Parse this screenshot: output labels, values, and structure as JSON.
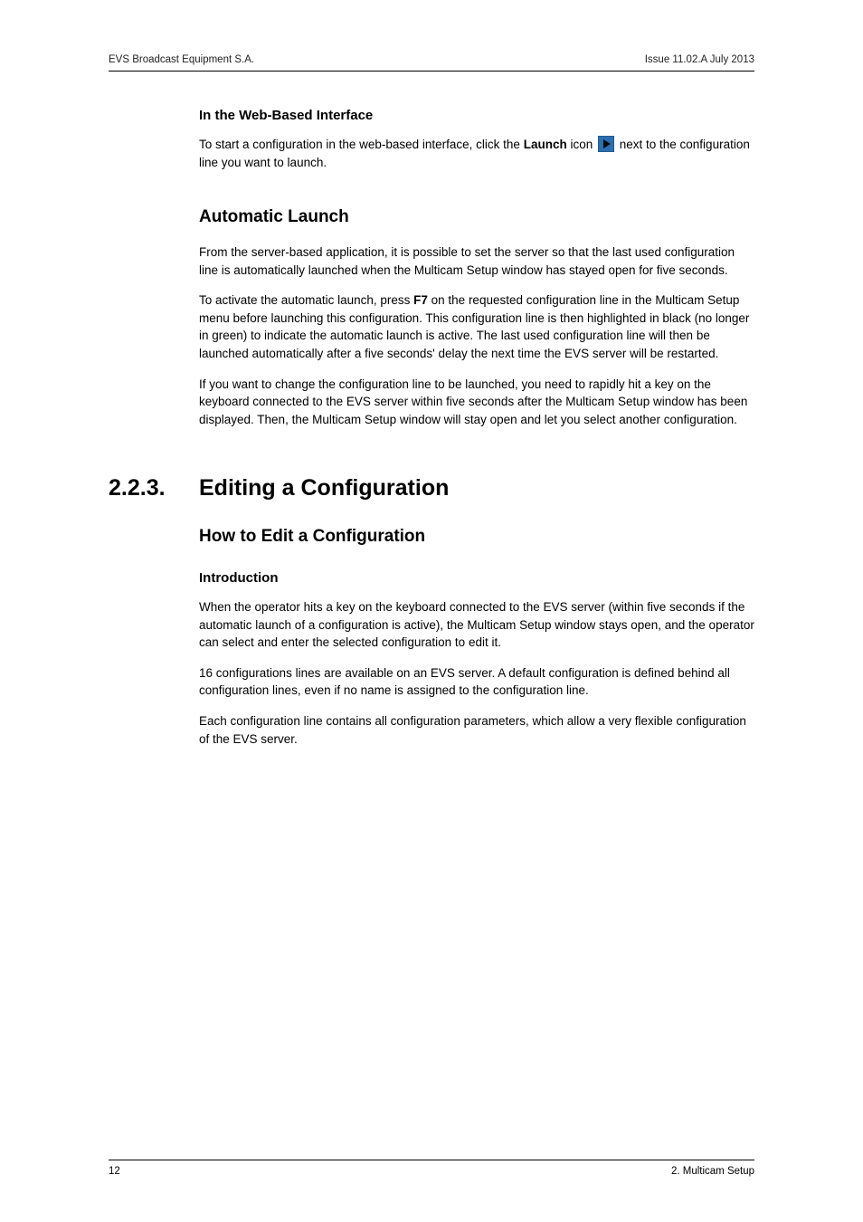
{
  "header": {
    "left": "EVS Broadcast Equipment S.A.",
    "right": "Issue 11.02.A  July 2013"
  },
  "sections": {
    "web_interface": {
      "heading": "In the Web-Based Interface",
      "p1a": "To start a configuration in the web-based interface, click the ",
      "p1_bold1": "Launch",
      "p1b": " icon ",
      "p1c": " next to the configuration line you want to launch."
    },
    "auto_launch": {
      "heading": "Automatic Launch",
      "p1": "From the server-based application, it is possible to set the server so that the last used configuration line is automatically launched when the Multicam Setup window has stayed open for five seconds.",
      "p2a": "To activate the automatic launch, press ",
      "p2_bold": "F7",
      "p2b": " on the requested configuration line in the Multicam Setup menu before launching this configuration. This configuration line is then highlighted in black (no longer in green) to indicate the automatic launch is active. The last used configuration line will then be launched automatically after a five seconds' delay the next time the EVS server will be restarted.",
      "p3": "If you want to change the configuration line to be launched, you need to rapidly hit a key on the keyboard connected to the EVS server within five seconds after the Multicam Setup window has been displayed. Then, the Multicam Setup window will stay open and let you select another configuration."
    },
    "editing": {
      "number": "2.2.3.",
      "title": "Editing a Configuration",
      "sub1": "How to Edit a Configuration",
      "intro_h": "Introduction",
      "p1": "When the operator hits a key on the keyboard connected to the EVS server (within five seconds if the automatic launch of a configuration is active), the Multicam Setup window stays open, and the operator can select and enter the selected configuration to edit it.",
      "p2": "16 configurations lines are available on an EVS server. A default configuration is defined behind all configuration lines, even if no name is assigned to the configuration line.",
      "p3": "Each configuration line contains all configuration parameters, which allow a very flexible configuration of the EVS server."
    }
  },
  "footer": {
    "left": "12",
    "right": "2. Multicam Setup"
  }
}
